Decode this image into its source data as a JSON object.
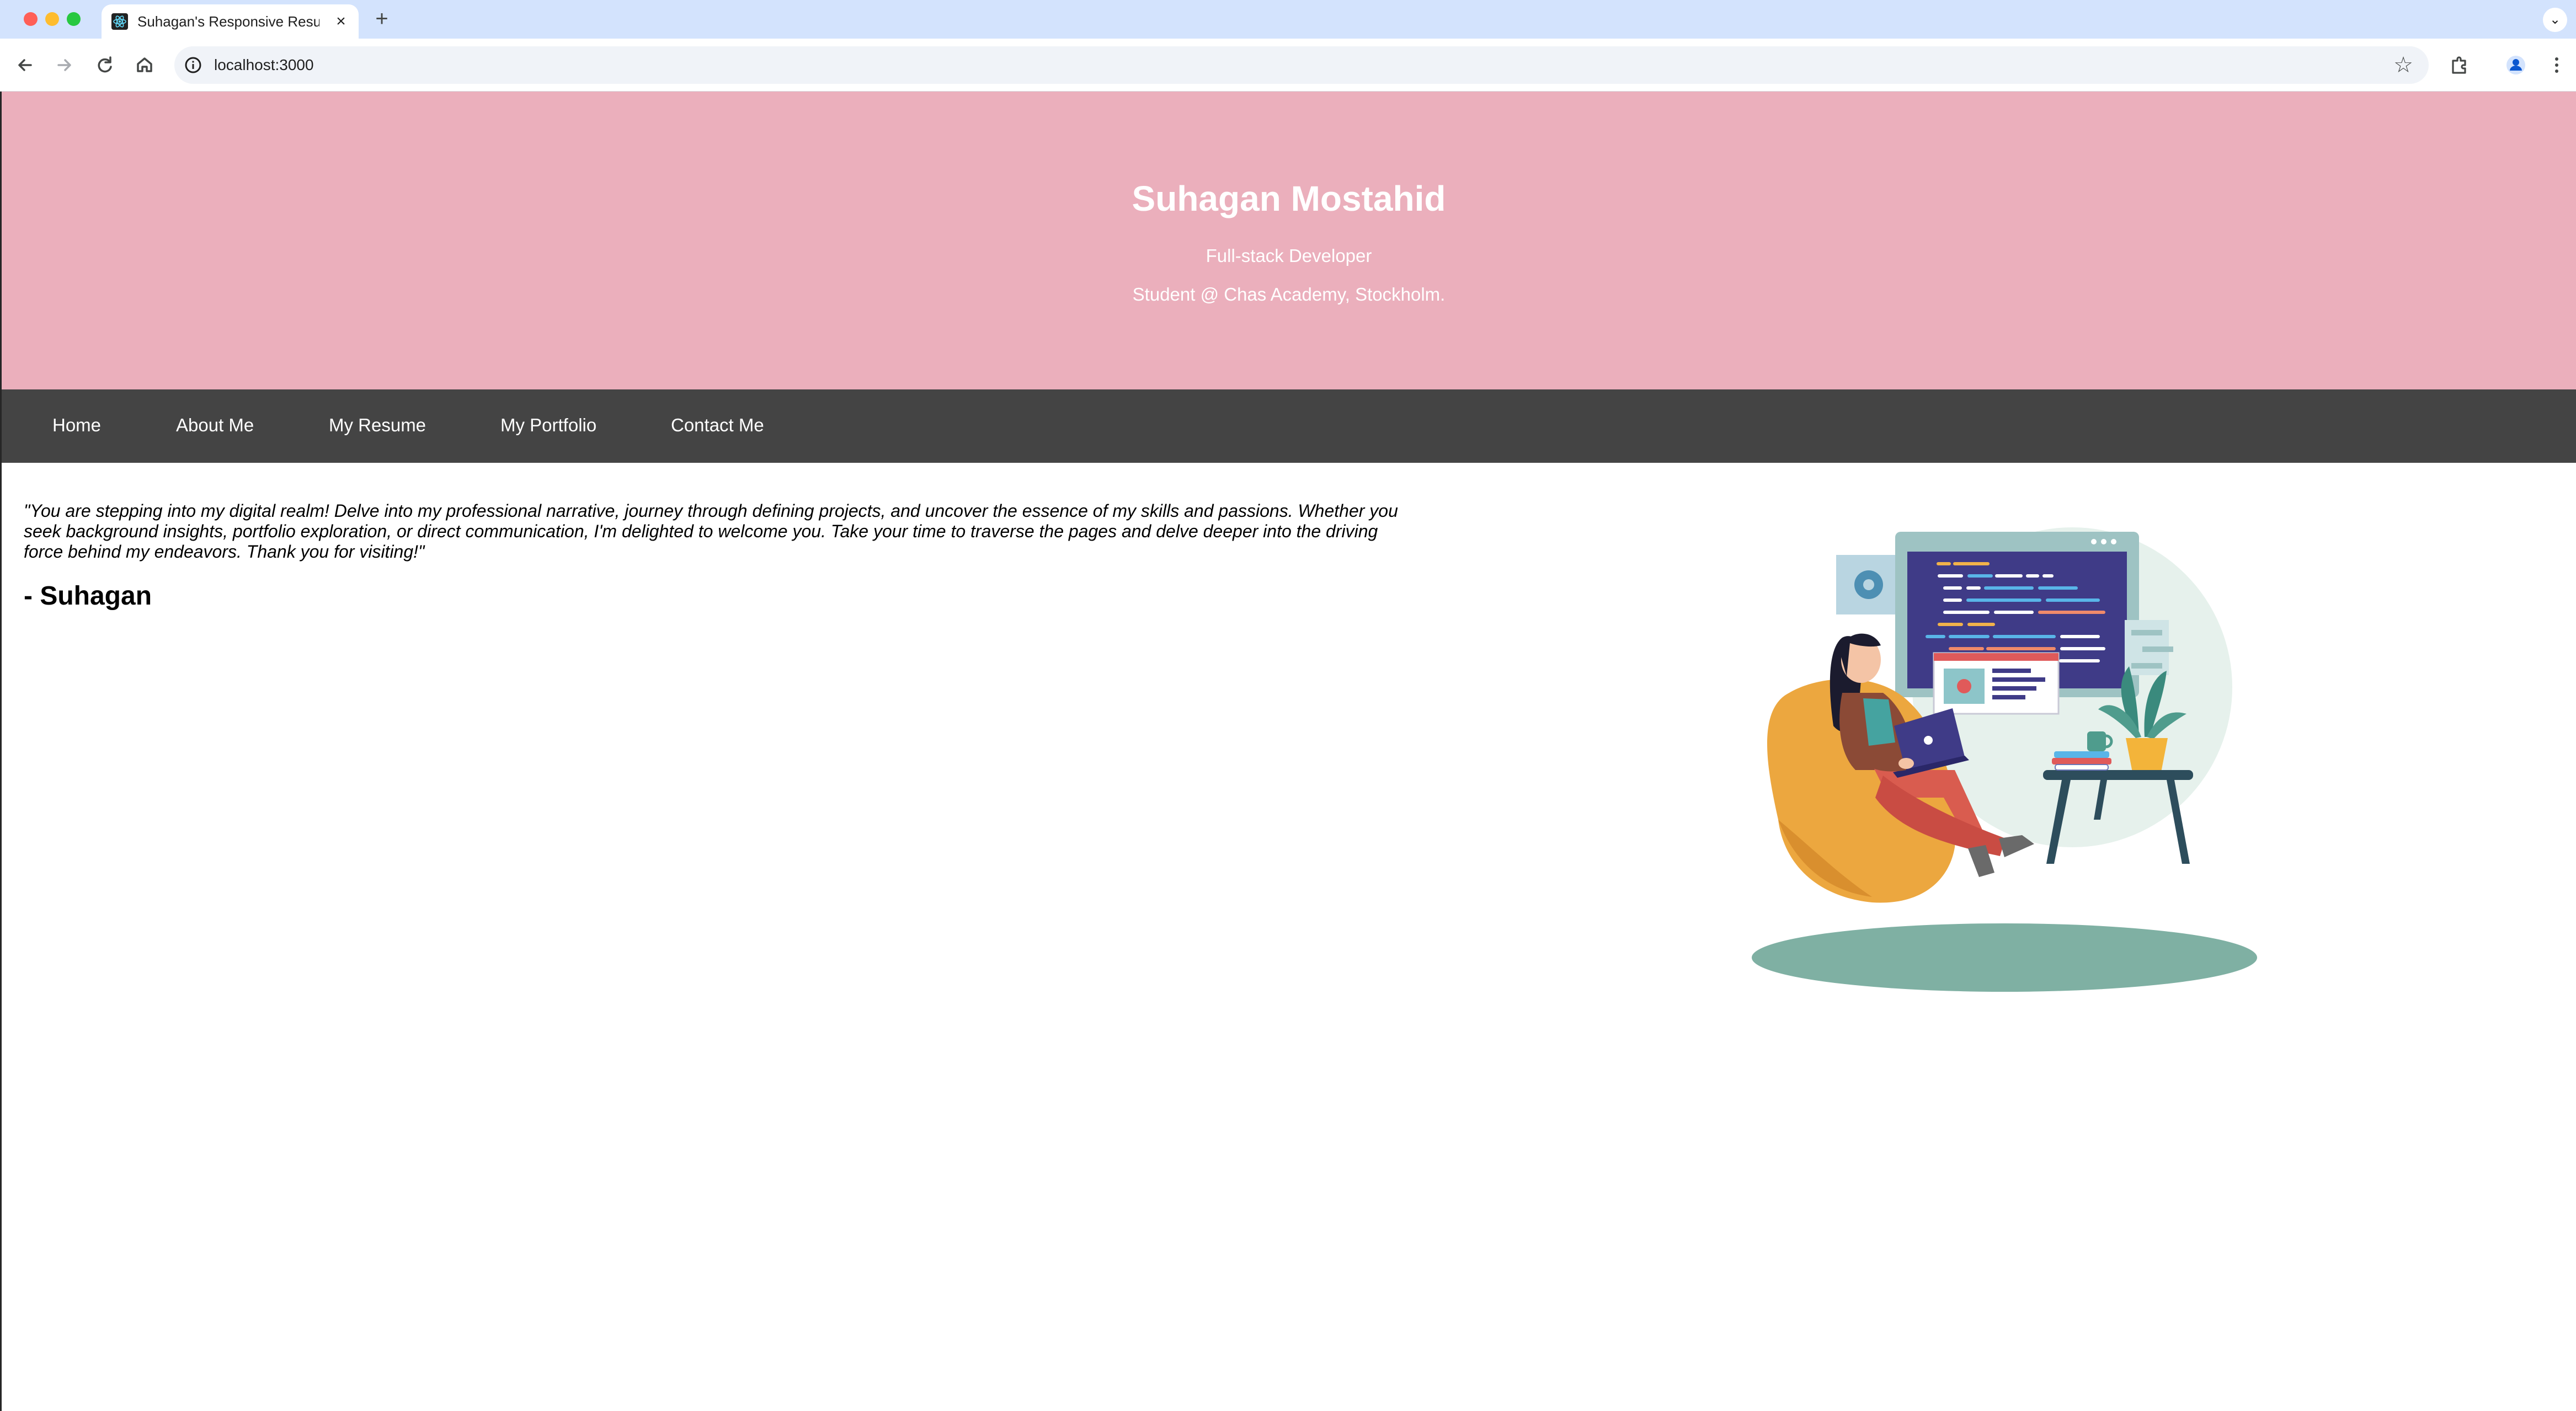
{
  "browser": {
    "tab": {
      "title": "Suhagan's Responsive Resume"
    },
    "address_bar": {
      "url": "localhost:3000"
    },
    "icons": [
      "react-favicon",
      "close-icon",
      "plus-icon",
      "chevron-down-icon",
      "back-arrow-icon",
      "forward-arrow-icon",
      "reload-icon",
      "home-icon",
      "site-info-icon",
      "star-icon",
      "extensions-icon",
      "profile-icon",
      "more-icon"
    ]
  },
  "hero": {
    "name": "Suhagan Mostahid",
    "role": "Full-stack Developer",
    "school": "Student @ Chas Academy, Stockholm."
  },
  "nav": {
    "items": [
      {
        "label": "Home"
      },
      {
        "label": "About Me"
      },
      {
        "label": "My Resume"
      },
      {
        "label": "My Portfolio"
      },
      {
        "label": "Contact Me"
      }
    ]
  },
  "main": {
    "quote": "\"You are stepping into my digital realm! Delve into my professional narrative, journey through defining projects, and uncover the essence of my skills and passions. Whether you seek background insights, portfolio exploration, or direct communication, I'm delighted to welcome you. Take your time to traverse the pages and delve deeper into the driving force behind my endeavors. Thank you for visiting!\"",
    "signature": "- Suhagan"
  },
  "colors": {
    "hero_bg": "#ebafbc",
    "nav_bg": "#444444",
    "tabbar_bg": "#d3e3fd"
  }
}
